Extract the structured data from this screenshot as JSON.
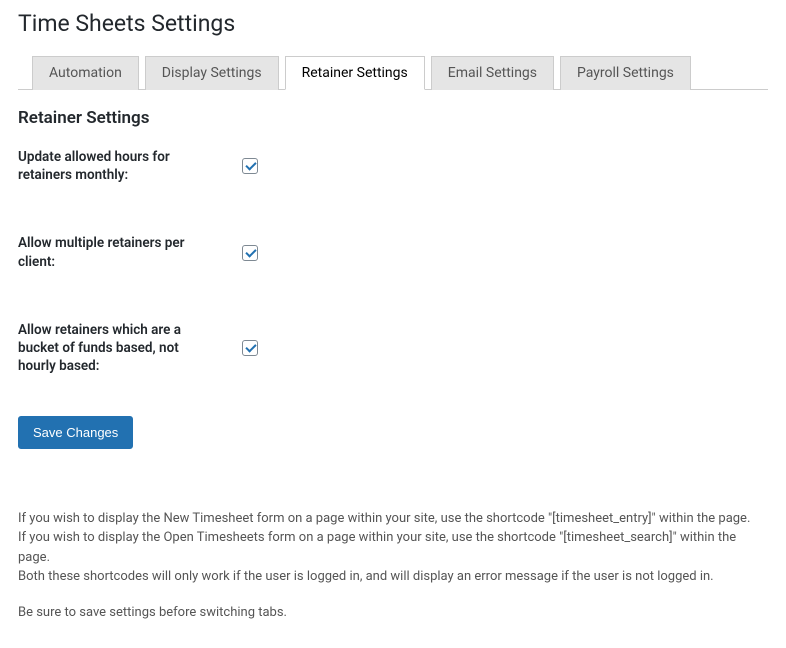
{
  "page": {
    "title": "Time Sheets Settings",
    "section_title": "Retainer Settings"
  },
  "tabs": [
    {
      "label": "Automation",
      "active": false
    },
    {
      "label": "Display Settings",
      "active": false
    },
    {
      "label": "Retainer Settings",
      "active": true
    },
    {
      "label": "Email Settings",
      "active": false
    },
    {
      "label": "Payroll Settings",
      "active": false
    }
  ],
  "settings": [
    {
      "label": "Update allowed hours for retainers monthly:",
      "checked": true
    },
    {
      "label": "Allow multiple retainers per client:",
      "checked": true
    },
    {
      "label": "Allow retainers which are a bucket of funds based, not hourly based:",
      "checked": true
    }
  ],
  "save_button": "Save Changes",
  "help": {
    "line1": "If you wish to display the New Timesheet form on a page within your site, use the shortcode \"[timesheet_entry]\" within the page.",
    "line2": "If you wish to display the Open Timesheets form on a page within your site, use the shortcode \"[timesheet_search]\" within the page.",
    "line3": "Both these shortcodes will only work if the user is logged in, and will display an error message if the user is not logged in.",
    "line4": "Be sure to save settings before switching tabs."
  }
}
